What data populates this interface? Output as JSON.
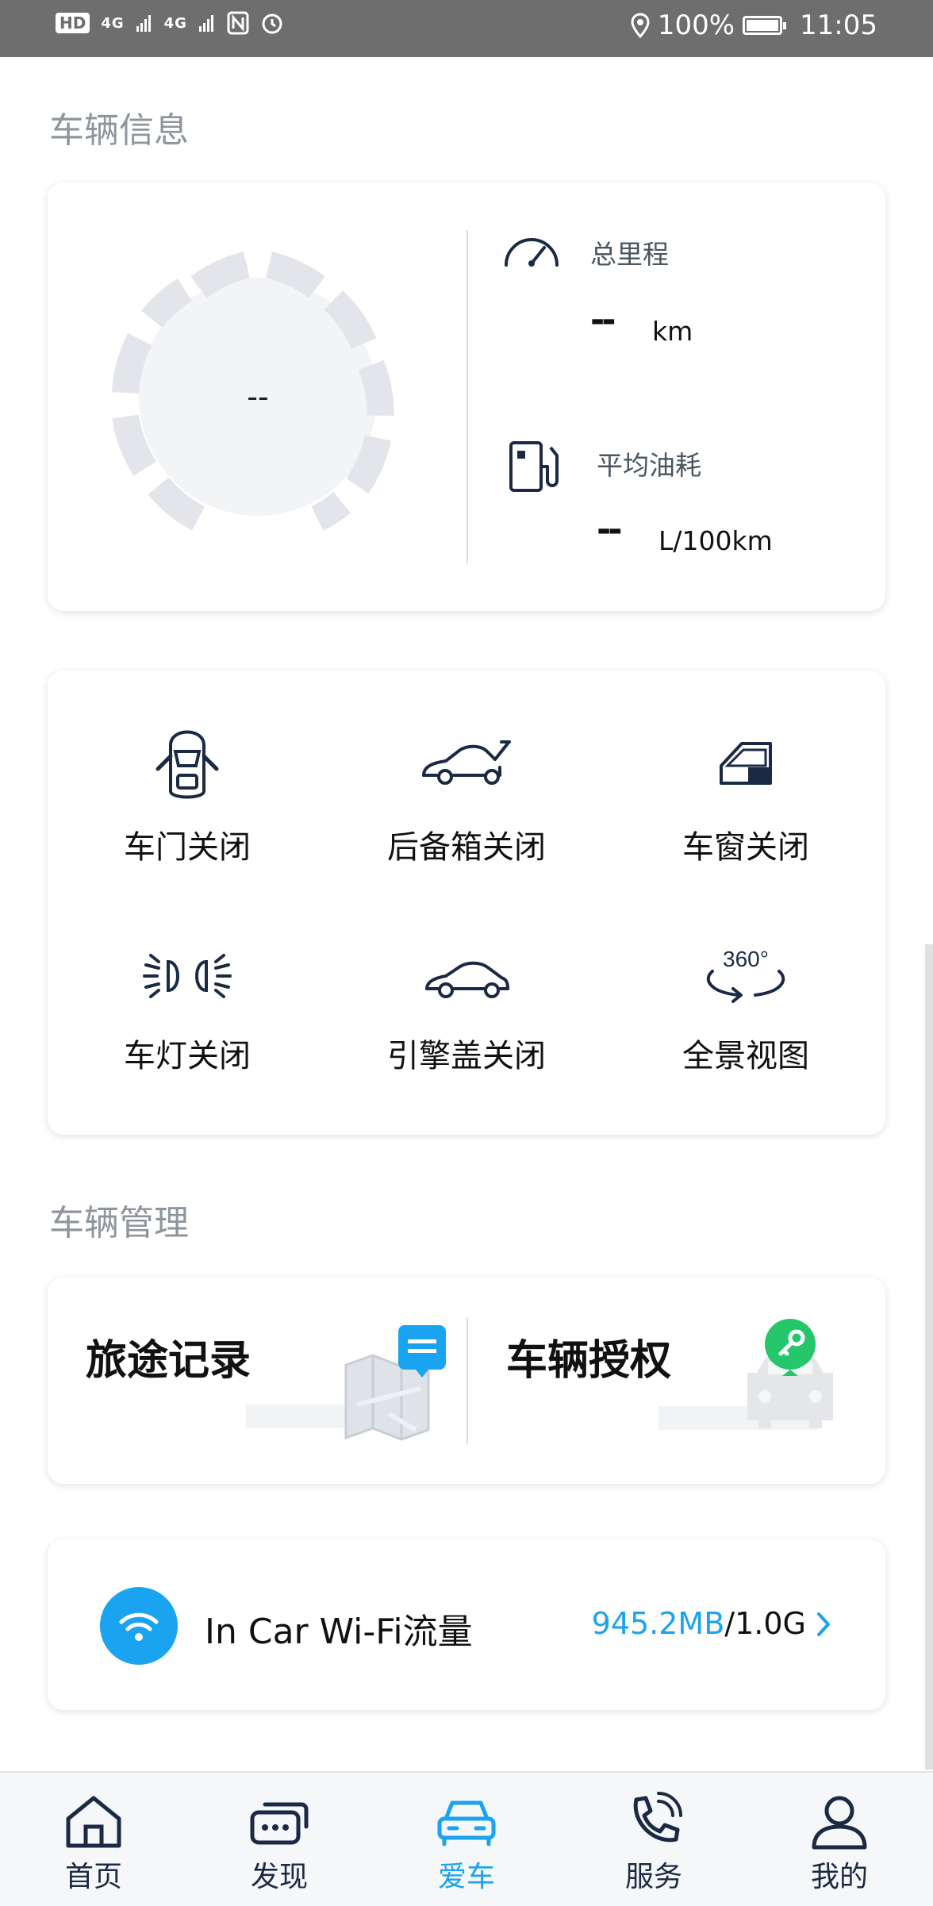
{
  "status_bar": {
    "hd": "HD",
    "network_1": "4G",
    "network_2": "4G",
    "battery_percent": "100%",
    "time": "11:05"
  },
  "vehicle_info": {
    "section_title": "车辆信息",
    "gauge_value": "--",
    "total_mileage_label": "总里程",
    "total_mileage_value": "--",
    "total_mileage_unit": "km",
    "avg_fuel_label": "平均油耗",
    "avg_fuel_value": "--",
    "avg_fuel_unit": "L/100km"
  },
  "vehicle_status": [
    {
      "label": "车门关闭",
      "icon": "car-door-icon"
    },
    {
      "label": "后备箱关闭",
      "icon": "trunk-icon"
    },
    {
      "label": "车窗关闭",
      "icon": "car-window-icon"
    },
    {
      "label": "车灯关闭",
      "icon": "headlight-icon"
    },
    {
      "label": "引擎盖关闭",
      "icon": "hood-icon"
    },
    {
      "label": "全景视图",
      "icon": "panorama-360-icon",
      "icon_text": "360°"
    }
  ],
  "vehicle_management": {
    "section_title": "车辆管理",
    "trip_record": "旅途记录",
    "vehicle_authorization": "车辆授权"
  },
  "wifi": {
    "label": "In Car Wi-Fi流量",
    "used": "945.2MB",
    "separator": "/",
    "total": "1.0G",
    "accent_color": "#1aa3f0"
  },
  "bottom_nav": {
    "items": [
      {
        "label": "首页",
        "icon": "home-icon"
      },
      {
        "label": "发现",
        "icon": "discover-chat-icon"
      },
      {
        "label": "爱车",
        "icon": "car-icon",
        "active": true
      },
      {
        "label": "服务",
        "icon": "phone-service-icon"
      },
      {
        "label": "我的",
        "icon": "user-icon"
      }
    ]
  }
}
